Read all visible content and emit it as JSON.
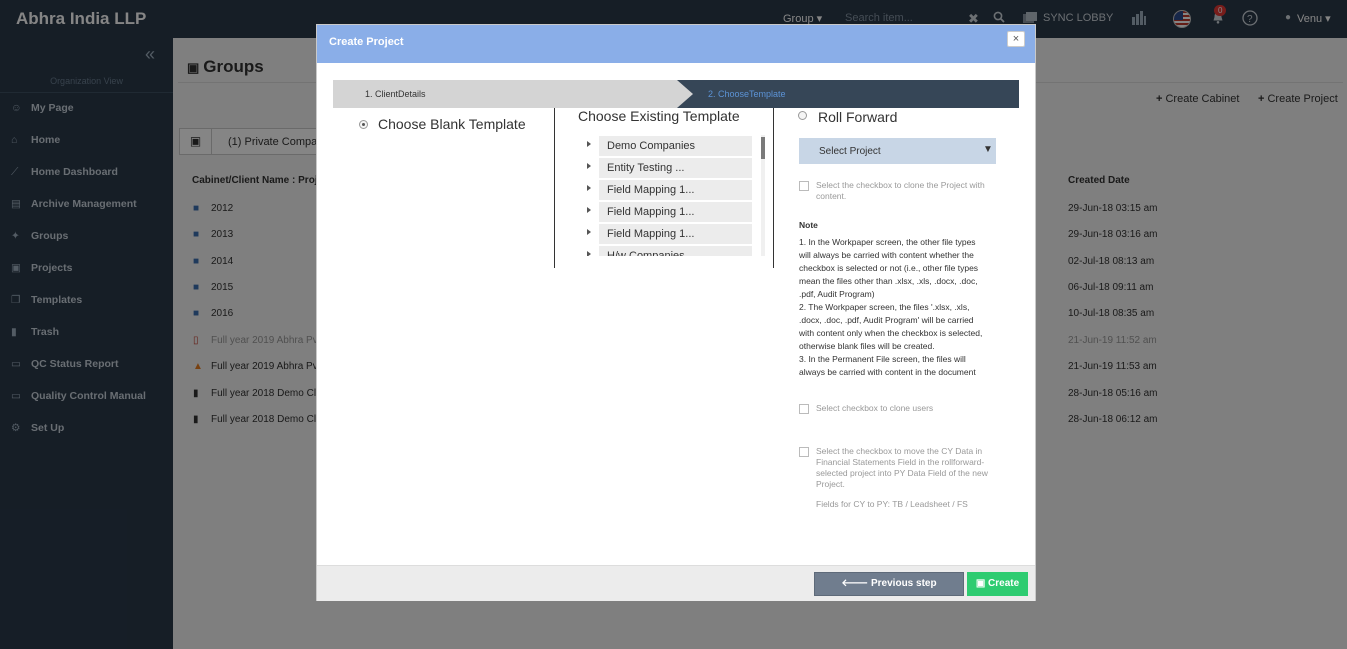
{
  "topbar": {
    "brand": "Abhra India LLP",
    "group_label": "Group ▾",
    "search_placeholder": "Search item...",
    "clear_icon": "✖",
    "search_icon": "search-icon",
    "sync_label": "SYNC LOBBY",
    "notification_count": "0",
    "user_label": "Venu ▾"
  },
  "sidebar": {
    "collapse_icon": "«",
    "org_view": "Organization View",
    "items": [
      {
        "label": "My Page",
        "icon": "☺"
      },
      {
        "label": "Home",
        "icon": "⌂"
      },
      {
        "label": "Home Dashboard",
        "icon": "⟋"
      },
      {
        "label": "Archive Management",
        "icon": "▤"
      },
      {
        "label": "Groups",
        "icon": "✦"
      },
      {
        "label": "Projects",
        "icon": "▣"
      },
      {
        "label": "Templates",
        "icon": "❐"
      },
      {
        "label": "Trash",
        "icon": "▮"
      },
      {
        "label": "QC Status Report",
        "icon": "▭"
      },
      {
        "label": "Quality Control Manual",
        "icon": "▭"
      },
      {
        "label": "Set Up",
        "icon": "⚙"
      }
    ]
  },
  "main": {
    "title": "Groups",
    "create_cabinet": "Create Cabinet",
    "create_project": "Create Project",
    "filter_label": "(1) Private Compan",
    "col_name": "Cabinet/Client Name : Project",
    "col_created": "Created Date",
    "rows": [
      {
        "name": "2012",
        "date": "29-Jun-18 03:15 am"
      },
      {
        "name": "2013",
        "date": "29-Jun-18 03:16 am"
      },
      {
        "name": "2014",
        "date": "02-Jul-18 08:13 am"
      },
      {
        "name": "2015",
        "date": "06-Jul-18 09:11 am"
      },
      {
        "name": "2016",
        "date": "10-Jul-18 08:35 am"
      },
      {
        "name": "Full year 2019 Abhra Pvt L",
        "date": "21-Jun-19 11:52 am"
      },
      {
        "name": "Full year 2019 Abhra Pvt Lt",
        "date": "21-Jun-19 11:53 am"
      },
      {
        "name": "Full year 2018 Demo Clien",
        "date": "28-Jun-18 05:16 am"
      },
      {
        "name": "Full year 2018 Demo Clien",
        "date": "28-Jun-18 06:12 am"
      }
    ]
  },
  "modal": {
    "title": "Create Project",
    "close": "×",
    "step1": "1. ClientDetails",
    "step2": "2. ChooseTemplate",
    "blank_template": "Choose Blank Template",
    "existing_template": "Choose Existing Template",
    "templates": [
      "Demo Companies",
      "Entity Testing ...",
      "Field Mapping 1...",
      "Field Mapping 1...",
      "Field Mapping 1...",
      "H/w Companies"
    ],
    "roll_forward": "Roll Forward",
    "select_project": "Select Project",
    "clone_content": "Select the checkbox to clone the Project with content.",
    "note_title": "Note",
    "note_lines": [
      "1. In the Workpaper screen, the other file types",
      "will always be carried with content whether the",
      "checkbox is selected or not (i.e., other file types",
      "mean the files other than .xlsx, .xls, .docx, .doc,",
      ".pdf, Audit Program)",
      "2. The Workpaper screen, the files '.xlsx, .xls,",
      ".docx, .doc, .pdf, Audit Program' will be carried",
      "with content only when the checkbox is selected,",
      "otherwise blank files will be created.",
      "3. In the Permanent File screen, the files will",
      "always be carried with content in the document"
    ],
    "clone_users": "Select checkbox to clone users",
    "move_cy": "Select the checkbox to move the CY Data in Financial Statements Field in the rollforward-selected project into PY Data Field of the new Project.",
    "fields_cy": "Fields for CY to PY: TB / Leadsheet / FS",
    "prev_btn": "Previous step",
    "create_btn": "Create"
  }
}
